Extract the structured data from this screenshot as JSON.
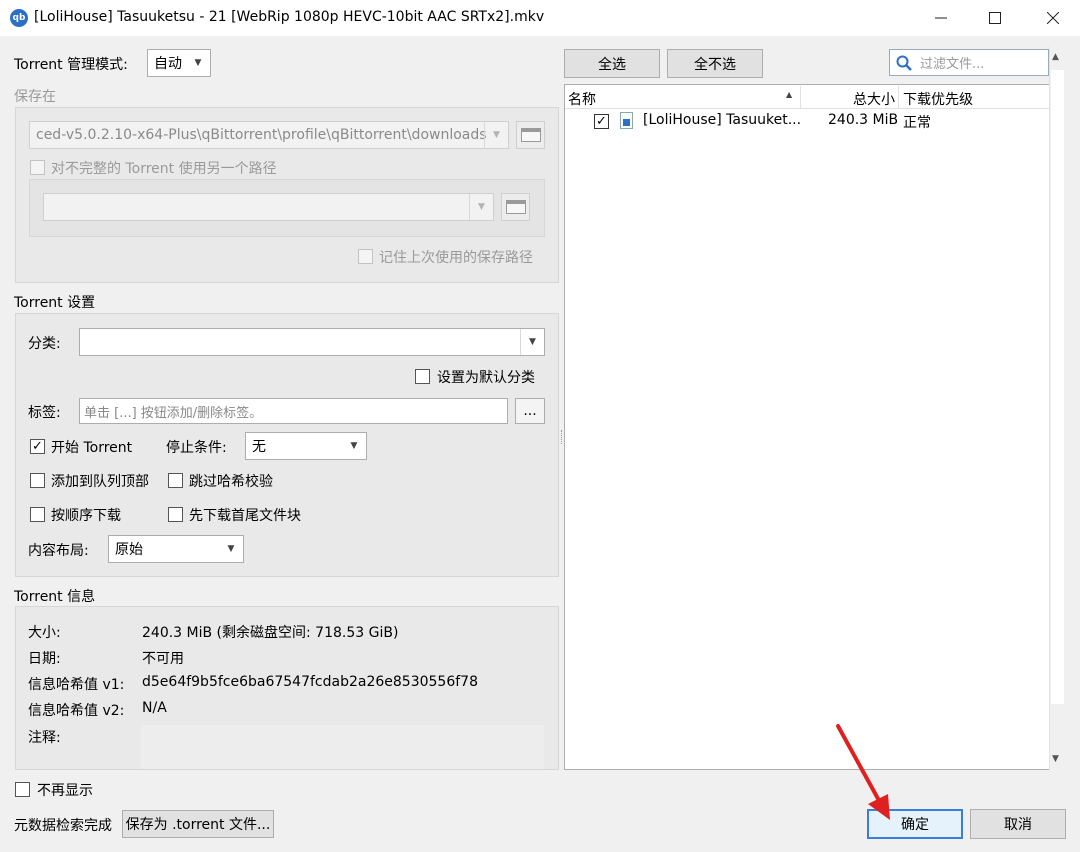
{
  "window": {
    "title": "[LoliHouse] Tasuuketsu - 21 [WebRip 1080p HEVC-10bit AAC SRTx2].mkv",
    "app_icon_text": "qb"
  },
  "left": {
    "mode_label": "Torrent 管理模式:",
    "mode_value": "自动",
    "save_in_label": "保存在",
    "save_path": "ced-v5.0.2.10-x64-Plus\\qBittorrent\\profile\\qBittorrent\\downloads",
    "alt_path_label": "对不完整的 Torrent 使用另一个路径",
    "alt_path_value": "",
    "remember_label": "记住上次使用的保存路径",
    "settings_title": "Torrent 设置",
    "category_label": "分类:",
    "category_value": "",
    "default_category_label": "设置为默认分类",
    "tags_label": "标签:",
    "tags_placeholder": "单击 [...] 按钮添加/删除标签。",
    "tags_button": "...",
    "start_torrent_label": "开始 Torrent",
    "stop_condition_label": "停止条件:",
    "stop_condition_value": "无",
    "add_top_queue_label": "添加到队列顶部",
    "skip_hash_label": "跳过哈希校验",
    "sequential_label": "按顺序下载",
    "first_last_label": "先下载首尾文件块",
    "layout_label": "内容布局:",
    "layout_value": "原始",
    "info_title": "Torrent 信息",
    "info": {
      "size_label": "大小:",
      "size_value": "240.3 MiB (剩余磁盘空间: 718.53 GiB)",
      "date_label": "日期:",
      "date_value": "不可用",
      "hash1_label": "信息哈希值 v1:",
      "hash1_value": "d5e64f9b5fce6ba67547fcdab2a26e8530556f78",
      "hash2_label": "信息哈希值 v2:",
      "hash2_value": "N/A",
      "comment_label": "注释:"
    }
  },
  "right": {
    "select_all": "全选",
    "select_none": "全不选",
    "filter_placeholder": "过滤文件...",
    "columns": {
      "name": "名称",
      "size": "总大小",
      "priority": "下载优先级"
    },
    "files": [
      {
        "name": "[LoliHouse] Tasuuket...",
        "size": "240.3 MiB",
        "priority": "正常",
        "checked": "✓"
      }
    ]
  },
  "footer": {
    "dont_show_label": "不再显示",
    "metadata_status": "元数据检索完成",
    "save_torrent_button": "保存为 .torrent 文件...",
    "ok_button": "确定",
    "cancel_button": "取消"
  },
  "colors": {
    "accent": "#3a7fd5",
    "arrow": "#e02020",
    "file_icon": "#2b6fc7"
  }
}
